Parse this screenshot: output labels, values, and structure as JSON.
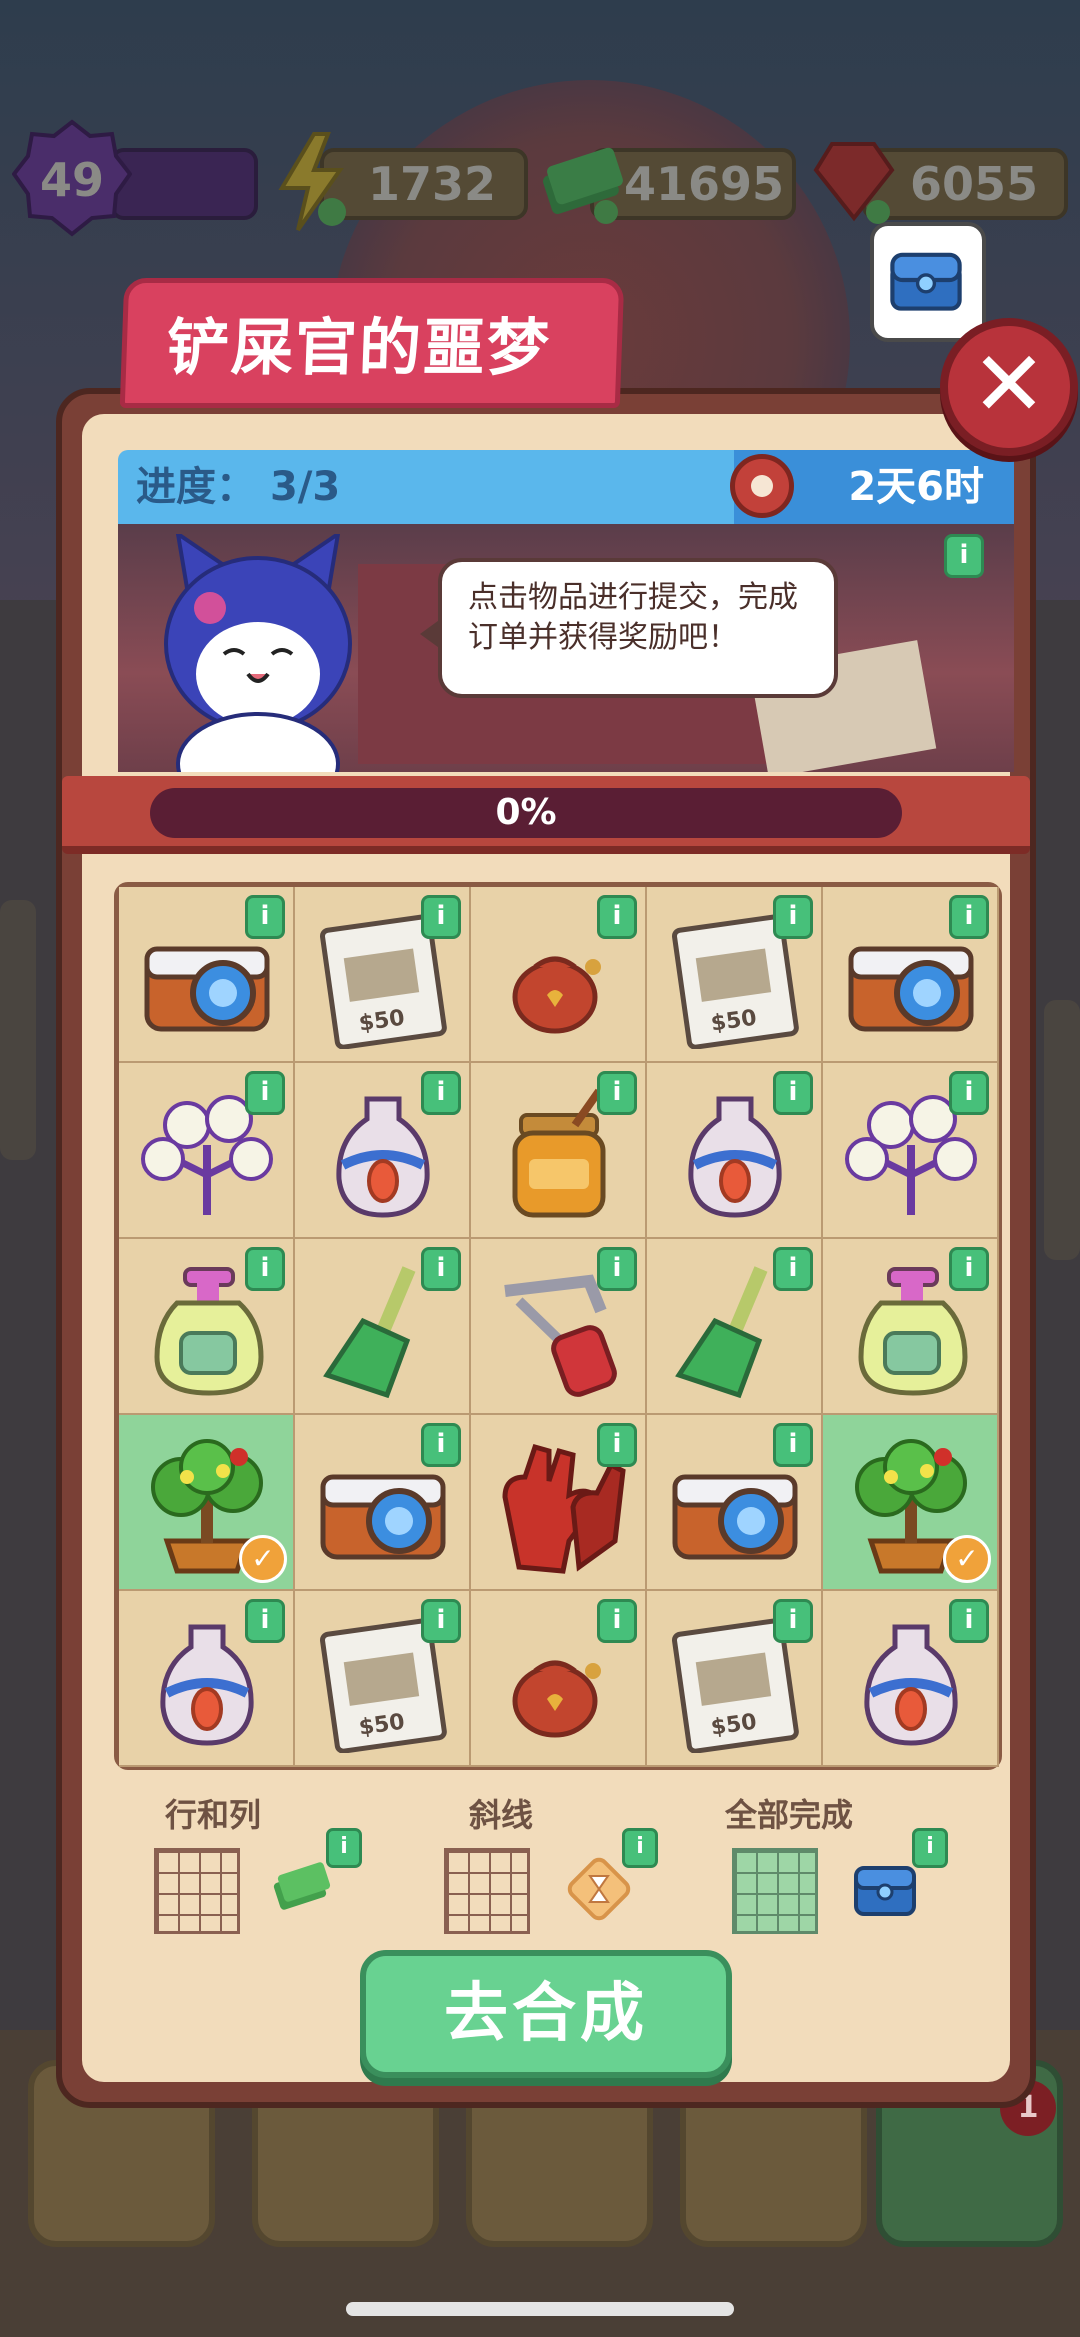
{
  "hud": {
    "level": "49",
    "energy": "1732",
    "cash": "41695",
    "gems": "6055"
  },
  "modal": {
    "title": "铲屎官的噩梦",
    "progress_label": "进度：",
    "progress_value": "3/3",
    "time_left": "2天6时",
    "speech": "点击物品进行提交，完成订单并获得奖励吧！",
    "progress_percent": "0%",
    "info_glyph": "i",
    "check_glyph": "✓",
    "close_glyph": "✕"
  },
  "grid": [
    [
      {
        "item": "camera-icon",
        "done": false
      },
      {
        "item": "wanted-poster-icon",
        "done": false
      },
      {
        "item": "pouch-icon",
        "done": false
      },
      {
        "item": "wanted-poster-icon",
        "done": false
      },
      {
        "item": "camera-icon",
        "done": false
      }
    ],
    [
      {
        "item": "cotton-plant-icon",
        "done": false
      },
      {
        "item": "vase-icon",
        "done": false
      },
      {
        "item": "honey-jar-icon",
        "done": false
      },
      {
        "item": "vase-icon",
        "done": false
      },
      {
        "item": "cotton-plant-icon",
        "done": false
      }
    ],
    [
      {
        "item": "soap-bottle-icon",
        "done": false
      },
      {
        "item": "broom-icon",
        "done": false
      },
      {
        "item": "saw-icon",
        "done": false
      },
      {
        "item": "broom-icon",
        "done": false
      },
      {
        "item": "soap-bottle-icon",
        "done": false
      }
    ],
    [
      {
        "item": "bonsai-tree-icon",
        "done": true
      },
      {
        "item": "camera-icon",
        "done": false
      },
      {
        "item": "gloves-icon",
        "done": false
      },
      {
        "item": "camera-icon",
        "done": false
      },
      {
        "item": "bonsai-tree-icon",
        "done": true
      }
    ],
    [
      {
        "item": "vase-icon",
        "done": false
      },
      {
        "item": "wanted-poster-icon",
        "done": false
      },
      {
        "item": "pouch-icon",
        "done": false
      },
      {
        "item": "wanted-poster-icon",
        "done": false
      },
      {
        "item": "vase-icon",
        "done": false
      }
    ]
  ],
  "rewards": {
    "rows_cols_label": "行和列",
    "diagonal_label": "斜线",
    "all_label": "全部完成"
  },
  "go_button": "去合成",
  "colors": {
    "accent_green": "#68d291",
    "title_pink": "#d9415f",
    "progress_blue": "#5ab7ec",
    "done_cell": "#8fd49a"
  }
}
